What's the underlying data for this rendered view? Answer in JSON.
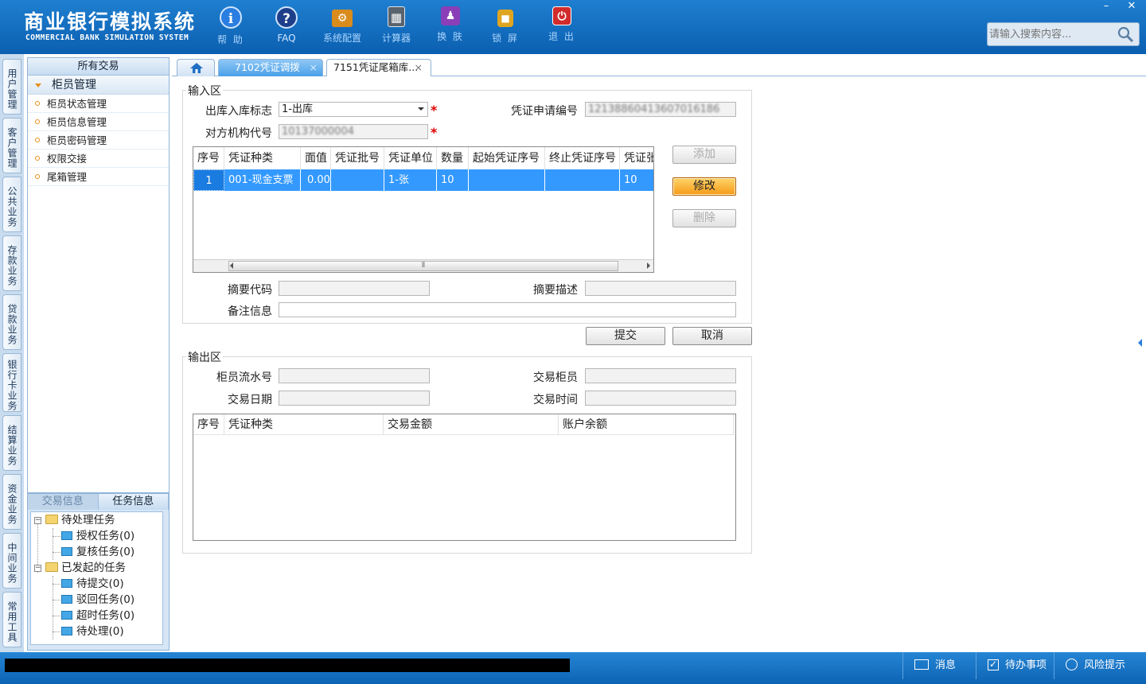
{
  "header": {
    "title_cn": "商业银行模拟系统",
    "title_en": "COMMERCIAL BANK SIMULATION SYSTEM",
    "toolbar": [
      {
        "label": "帮 助",
        "icon": "info-icon",
        "glyph": "i",
        "color": "#2a7de1"
      },
      {
        "label": "FAQ",
        "icon": "question-icon",
        "glyph": "?",
        "color": "#1e3f8a"
      },
      {
        "label": "系统配置",
        "icon": "toolbox-icon",
        "glyph": "⚙",
        "color": "#d98b1c"
      },
      {
        "label": "计算器",
        "icon": "calculator-icon",
        "glyph": "▦",
        "color": "#6a7480"
      },
      {
        "label": "换 肤",
        "icon": "shirt-icon",
        "glyph": "♟",
        "color": "#8a3fb8"
      },
      {
        "label": "锁 屏",
        "icon": "lock-icon",
        "glyph": "🔒",
        "color": "#e0a520"
      },
      {
        "label": "退 出",
        "icon": "power-icon",
        "glyph": "⏻",
        "color": "#d12b2b"
      }
    ],
    "search": {
      "placeholder": "请输入搜索内容..."
    },
    "window": {
      "minimize": "–",
      "close": "✕"
    }
  },
  "side_tabs": [
    "用户管理",
    "客户管理",
    "公共业务",
    "存款业务",
    "贷款业务",
    "银行卡业务",
    "结算业务",
    "资金业务",
    "中间业务",
    "常用工具"
  ],
  "nav": {
    "title": "所有交易",
    "group": "柜员管理",
    "items": [
      "柜员状态管理",
      "柜员信息管理",
      "柜员密码管理",
      "权限交接",
      "尾箱管理"
    ]
  },
  "task_panel": {
    "tabs": [
      "交易信息",
      "任务信息"
    ],
    "tree": [
      {
        "label": "待处理任务",
        "level": 0
      },
      {
        "label": "授权任务(0)",
        "level": 1
      },
      {
        "label": "复核任务(0)",
        "level": 1
      },
      {
        "label": "已发起的任务",
        "level": 0
      },
      {
        "label": "待提交(0)",
        "level": 1
      },
      {
        "label": "驳回任务(0)",
        "level": 1
      },
      {
        "label": "超时任务(0)",
        "level": 1
      },
      {
        "label": "待处理(0)",
        "level": 1
      }
    ]
  },
  "page_tabs": [
    {
      "label": "",
      "icon": "home-icon"
    },
    {
      "label": "7102凭证调拨",
      "close": "×"
    },
    {
      "label": "7151凭证尾箱库...",
      "close": "×"
    }
  ],
  "input_area": {
    "legend": "输入区",
    "in_out_flag": {
      "label": "出库入库标志",
      "value": "1-出库"
    },
    "voucher_apply_no": {
      "label": "凭证申请编号",
      "value": "12138860413607016186"
    },
    "counterparty_org": {
      "label": "对方机构代号",
      "value": "10137000004"
    },
    "required_mark": "*",
    "table": {
      "headers": [
        "序号",
        "凭证种类",
        "面值",
        "凭证批号",
        "凭证单位",
        "数量",
        "起始凭证序号",
        "终止凭证序号",
        "凭证张"
      ],
      "rows": [
        [
          "1",
          "001-现金支票",
          "0.00",
          "",
          "1-张",
          "10",
          "",
          "",
          "10"
        ]
      ],
      "scroll_thumb": "⦀"
    },
    "summary_code": {
      "label": "摘要代码",
      "value": ""
    },
    "summary_desc": {
      "label": "摘要描述",
      "value": ""
    },
    "remark": {
      "label": "备注信息",
      "value": ""
    },
    "buttons": {
      "add": "添加",
      "modify": "修改",
      "delete": "删除"
    }
  },
  "actions": {
    "submit": "提交",
    "cancel": "取消"
  },
  "output_area": {
    "legend": "输出区",
    "teller_serial": {
      "label": "柜员流水号",
      "value": ""
    },
    "txn_teller": {
      "label": "交易柜员",
      "value": ""
    },
    "txn_date": {
      "label": "交易日期",
      "value": ""
    },
    "txn_time": {
      "label": "交易时间",
      "value": ""
    },
    "table": {
      "headers": [
        "序号",
        "凭证种类",
        "交易金额",
        "账户余额"
      ],
      "rows": []
    }
  },
  "statusbar": {
    "message": "消息",
    "todo": "待办事项",
    "risk": "风险提示"
  },
  "colors": {
    "header": "#0b5fb0",
    "selected_row": "#3399ff",
    "accent": "#f59a16"
  }
}
